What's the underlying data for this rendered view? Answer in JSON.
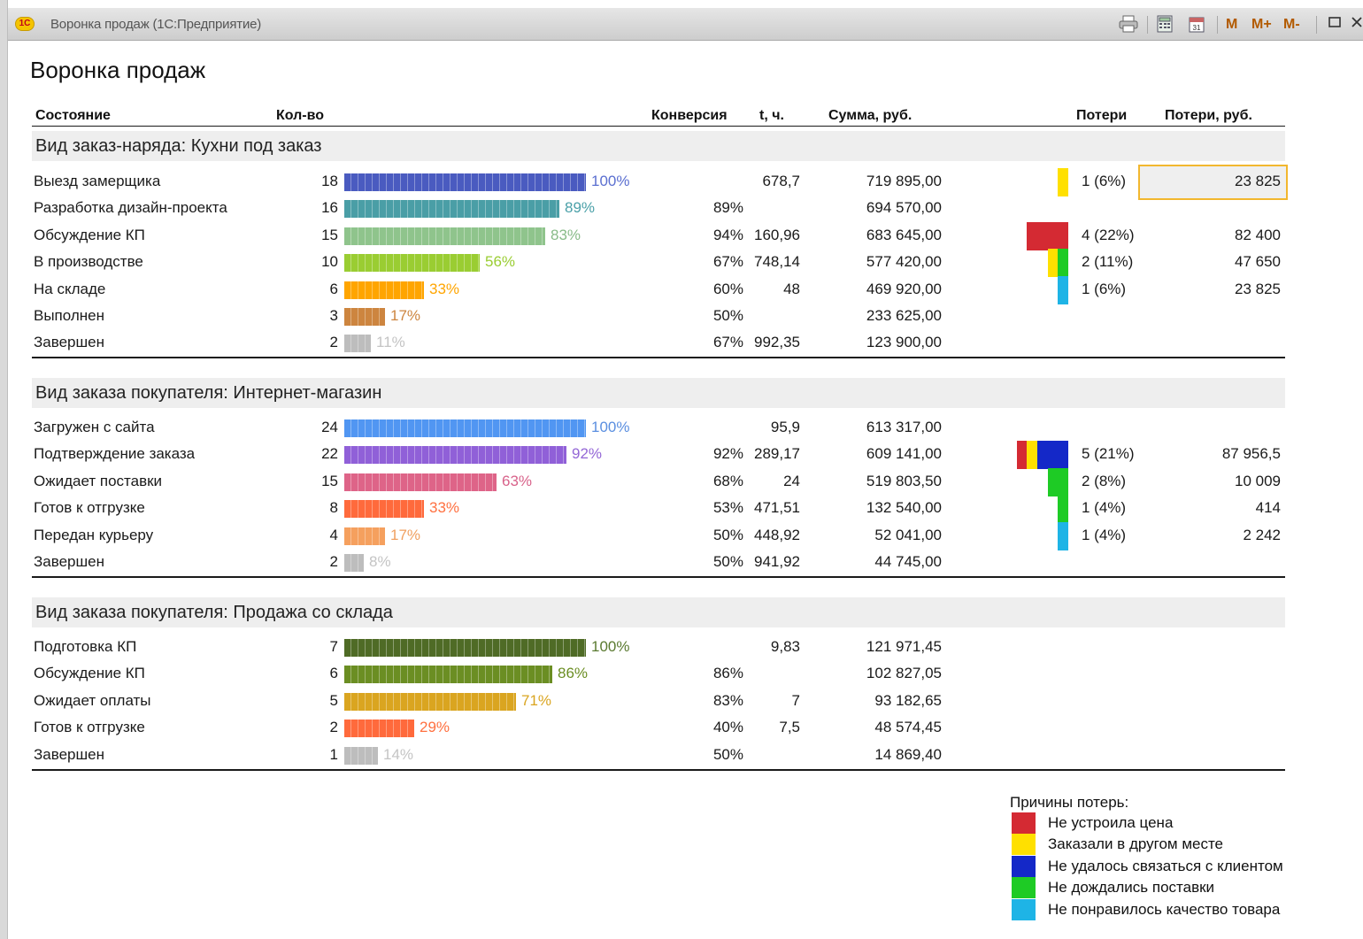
{
  "window": {
    "logo_text": "1С",
    "title": "Воронка продаж  (1С:Предприятие)",
    "memory_buttons": [
      "M",
      "M+",
      "M-"
    ],
    "icons": [
      "print-icon",
      "calculator-icon",
      "calendar-icon",
      "maximize-icon",
      "close-icon"
    ]
  },
  "report": {
    "title": "Воронка продаж",
    "headers": {
      "state": "Состояние",
      "qty": "Кол-во",
      "conversion": "Конверсия",
      "time": "t, ч.",
      "sum": "Сумма, руб.",
      "losses": "Потери",
      "losses_rub": "Потери, руб."
    },
    "groups": [
      {
        "title": "Вид заказ-наряда: Кухни под заказ",
        "rows": [
          {
            "state": "Выезд замерщика",
            "qty": "18",
            "share": 1.0,
            "pct": "100%",
            "bar_color": "#4a5bc0",
            "pct_color": "#5b6fd0",
            "conversion": "",
            "time": "678,7",
            "sum": "719 895,00",
            "losses": "1 (6%)",
            "losses_rub": "23 825",
            "loss_segments": [
              {
                "reason": "yellow",
                "color": "#ffe000",
                "count": 1
              }
            ]
          },
          {
            "state": "Разработка дизайн-проекта",
            "qty": "16",
            "share": 0.89,
            "pct": "89%",
            "bar_color": "#4a9ea6",
            "pct_color": "#4aa0a8",
            "conversion": "89%",
            "time": "",
            "sum": "694 570,00",
            "losses": "",
            "losses_rub": "",
            "loss_segments": []
          },
          {
            "state": "Обсуждение КП",
            "qty": "15",
            "share": 0.83,
            "pct": "83%",
            "bar_color": "#8fc48c",
            "pct_color": "#88bb88",
            "conversion": "94%",
            "time": "160,96",
            "sum": "683 645,00",
            "losses": "4 (22%)",
            "losses_rub": "82 400",
            "loss_segments": [
              {
                "reason": "red",
                "color": "#d42a33",
                "count": 4
              }
            ]
          },
          {
            "state": "В производстве",
            "qty": "10",
            "share": 0.56,
            "pct": "56%",
            "bar_color": "#9acd32",
            "pct_color": "#9acd32",
            "conversion": "67%",
            "time": "748,14",
            "sum": "577 420,00",
            "losses": "2 (11%)",
            "losses_rub": "47 650",
            "loss_segments": [
              {
                "reason": "yellow",
                "color": "#ffe000",
                "count": 1
              },
              {
                "reason": "green",
                "color": "#1ecb25",
                "count": 1
              }
            ]
          },
          {
            "state": "На складе",
            "qty": "6",
            "share": 0.33,
            "pct": "33%",
            "bar_color": "#ffa500",
            "pct_color": "#ffa500",
            "conversion": "60%",
            "time": "48",
            "sum": "469 920,00",
            "losses": "1 (6%)",
            "losses_rub": "23 825",
            "loss_segments": [
              {
                "reason": "cyan",
                "color": "#1eb4e6",
                "count": 1
              }
            ]
          },
          {
            "state": "Выполнен",
            "qty": "3",
            "share": 0.17,
            "pct": "17%",
            "bar_color": "#cd853f",
            "pct_color": "#cd853f",
            "conversion": "50%",
            "time": "",
            "sum": "233 625,00",
            "losses": "",
            "losses_rub": "",
            "loss_segments": []
          },
          {
            "state": "Завершен",
            "qty": "2",
            "share": 0.11,
            "pct": "11%",
            "bar_color": "#bdbdbd",
            "pct_color": "#c4c4c4",
            "conversion": "67%",
            "time": "992,35",
            "sum": "123 900,00",
            "losses": "",
            "losses_rub": "",
            "loss_segments": []
          }
        ]
      },
      {
        "title": "Вид заказа покупателя: Интернет-магазин",
        "rows": [
          {
            "state": "Загружен с сайта",
            "qty": "24",
            "share": 1.0,
            "pct": "100%",
            "bar_color": "#5196f2",
            "pct_color": "#5b8fe0",
            "conversion": "",
            "time": "95,9",
            "sum": "613 317,00",
            "losses": "",
            "losses_rub": "",
            "loss_segments": []
          },
          {
            "state": "Подтверждение заказа",
            "qty": "22",
            "share": 0.92,
            "pct": "92%",
            "bar_color": "#9060d8",
            "pct_color": "#9366d6",
            "conversion": "92%",
            "time": "289,17",
            "sum": "609 141,00",
            "losses": "5 (21%)",
            "losses_rub": "87 956,5",
            "loss_segments": [
              {
                "reason": "red",
                "color": "#d42a33",
                "count": 1
              },
              {
                "reason": "yellow",
                "color": "#ffe000",
                "count": 1
              },
              {
                "reason": "blue",
                "color": "#1428c8",
                "count": 3
              }
            ]
          },
          {
            "state": "Ожидает поставки",
            "qty": "15",
            "share": 0.63,
            "pct": "63%",
            "bar_color": "#de6488",
            "pct_color": "#d8628a",
            "conversion": "68%",
            "time": "24",
            "sum": "519 803,50",
            "losses": "2 (8%)",
            "losses_rub": "10 009",
            "loss_segments": [
              {
                "reason": "green",
                "color": "#1ecb25",
                "count": 2
              }
            ]
          },
          {
            "state": "Готов к отгрузке",
            "qty": "8",
            "share": 0.33,
            "pct": "33%",
            "bar_color": "#ff6a3c",
            "pct_color": "#ff7040",
            "conversion": "53%",
            "time": "471,51",
            "sum": "132 540,00",
            "losses": "1 (4%)",
            "losses_rub": "414",
            "loss_segments": [
              {
                "reason": "green",
                "color": "#1ecb25",
                "count": 1
              }
            ]
          },
          {
            "state": "Передан курьеру",
            "qty": "4",
            "share": 0.17,
            "pct": "17%",
            "bar_color": "#f5a05e",
            "pct_color": "#f0a060",
            "conversion": "50%",
            "time": "448,92",
            "sum": "52 041,00",
            "losses": "1 (4%)",
            "losses_rub": "2 242",
            "loss_segments": [
              {
                "reason": "cyan",
                "color": "#1eb4e6",
                "count": 1
              }
            ]
          },
          {
            "state": "Завершен",
            "qty": "2",
            "share": 0.08,
            "pct": "8%",
            "bar_color": "#bdbdbd",
            "pct_color": "#c4c4c4",
            "conversion": "50%",
            "time": "941,92",
            "sum": "44 745,00",
            "losses": "",
            "losses_rub": "",
            "loss_segments": []
          }
        ]
      },
      {
        "title": "Вид заказа покупателя: Продажа со склада",
        "rows": [
          {
            "state": "Подготовка КП",
            "qty": "7",
            "share": 1.0,
            "pct": "100%",
            "bar_color": "#4f6b26",
            "pct_color": "#5a7a30",
            "conversion": "",
            "time": "9,83",
            "sum": "121 971,45",
            "losses": "",
            "losses_rub": "",
            "loss_segments": []
          },
          {
            "state": "Обсуждение КП",
            "qty": "6",
            "share": 0.86,
            "pct": "86%",
            "bar_color": "#6b8e23",
            "pct_color": "#6b8e23",
            "conversion": "86%",
            "time": "",
            "sum": "102 827,05",
            "losses": "",
            "losses_rub": "",
            "loss_segments": []
          },
          {
            "state": "Ожидает оплаты",
            "qty": "5",
            "share": 0.71,
            "pct": "71%",
            "bar_color": "#daa520",
            "pct_color": "#daa520",
            "conversion": "83%",
            "time": "7",
            "sum": "93 182,65",
            "losses": "",
            "losses_rub": "",
            "loss_segments": []
          },
          {
            "state": "Готов к отгрузке",
            "qty": "2",
            "share": 0.29,
            "pct": "29%",
            "bar_color": "#ff6a3c",
            "pct_color": "#ff7040",
            "conversion": "40%",
            "time": "7,5",
            "sum": "48 574,45",
            "losses": "",
            "losses_rub": "",
            "loss_segments": []
          },
          {
            "state": "Завершен",
            "qty": "1",
            "share": 0.14,
            "pct": "14%",
            "bar_color": "#bdbdbd",
            "pct_color": "#c4c4c4",
            "conversion": "50%",
            "time": "",
            "sum": "14 869,40",
            "losses": "",
            "losses_rub": "",
            "loss_segments": []
          }
        ]
      }
    ],
    "legend": {
      "title": "Причины потерь:",
      "items": [
        {
          "label": "Не устроила цена",
          "color": "#d42a33"
        },
        {
          "label": "Заказали в другом месте",
          "color": "#ffe000"
        },
        {
          "label": "Не удалось связаться с клиентом",
          "color": "#1428c8"
        },
        {
          "label": "Не дождались поставки",
          "color": "#1ecb25"
        },
        {
          "label": "Не понравилось качество товара",
          "color": "#1eb4e6"
        }
      ]
    }
  }
}
